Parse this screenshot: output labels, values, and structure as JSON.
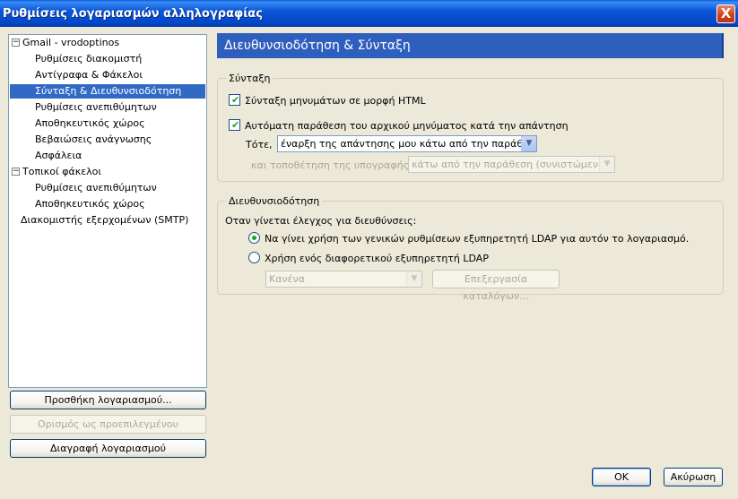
{
  "window": {
    "title": "Ρυθμίσεις λογαριασμών αλληλογραφίας",
    "close_label": "X"
  },
  "tree": {
    "items": [
      {
        "label": "Gmail - vrodoptinos",
        "expander": "−"
      },
      {
        "label": "Ρυθμίσεις διακομιστή"
      },
      {
        "label": "Αντίγραφα & Φάκελοι"
      },
      {
        "label": "Σύνταξη & Διευθυνσιοδότηση",
        "selected": true
      },
      {
        "label": "Ρυθμίσεις ανεπιθύμητων"
      },
      {
        "label": "Αποθηκευτικός χώρος"
      },
      {
        "label": "Βεβαιώσεις ανάγνωσης"
      },
      {
        "label": "Ασφάλεια"
      },
      {
        "label": "Τοπικοί φάκελοι",
        "expander": "−"
      },
      {
        "label": "Ρυθμίσεις ανεπιθύμητων"
      },
      {
        "label": "Αποθηκευτικός χώρος"
      },
      {
        "label": "Διακομιστής εξερχομένων (SMTP)"
      }
    ]
  },
  "side_buttons": {
    "add_account": "Προσθήκη λογαριασμού...",
    "set_default": "Ορισμός ως προεπιλεγμένου",
    "delete_account": "Διαγραφή λογαριασμού"
  },
  "panel": {
    "header": "Διευθυνσιοδότηση & Σύνταξη",
    "composition": {
      "legend": "Σύνταξη",
      "html_compose": {
        "label": "Σύνταξη μηνυμάτων σε μορφή HTML",
        "checked": true
      },
      "auto_quote": {
        "label": "Αυτόματη παράθεση του αρχικού μηνύματος κατά την απάντηση",
        "checked": true
      },
      "then_label": "Τότε,",
      "then_value": "έναρξη της απάντησης μου κάτω από την παράθεση",
      "signature_label": "και τοποθέτηση της υπογραφής μου",
      "signature_value": "κάτω από την παράθεση (συνιστώμενο)"
    },
    "addressing": {
      "legend": "Διευθυνσιοδότηση",
      "intro": "Οταν γίνεται έλεγχος για διευθύνσεις:",
      "global_ldap": {
        "label": "Να γίνει χρήση των γενικών ρυθμίσεων εξυπηρετητή LDAP για αυτόν το λογαριασμό.",
        "selected": true
      },
      "other_ldap": {
        "label": "Χρήση ενός διαφορετικού εξυπηρετητή LDAP",
        "selected": false
      },
      "ldap_select": "Κανένα",
      "edit_directories": "Επεξεργασία καταλόγων..."
    }
  },
  "footer": {
    "ok": "OK",
    "cancel": "Ακύρωση"
  }
}
